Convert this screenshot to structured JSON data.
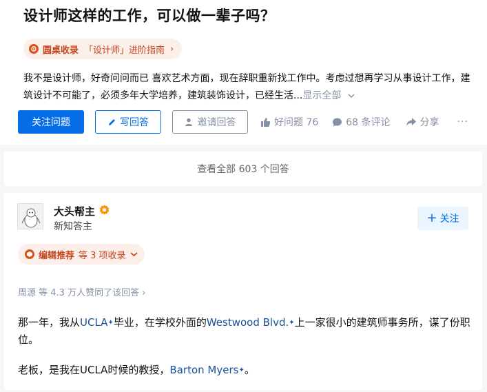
{
  "question": {
    "title": "设计师这样的工作，可以做一辈子吗？",
    "collection": {
      "name": "圆桌收录",
      "topic": "「设计师」进阶指南",
      "arrow": "›"
    },
    "description": "我不是设计师，好奇问问而已 喜欢艺术方面，现在辞职重新找工作中。考虑过想再学习从事设计工作，建筑设计不可能了，必须多年大学培养，建筑装饰设计，已经生活...",
    "show_all": "显示全部",
    "show_all_icon": "chevron-down-icon"
  },
  "actions": {
    "follow": "关注问题",
    "write": "写回答",
    "invite": "邀请回答",
    "good_question": "好问题 76",
    "comments": "68 条评论",
    "share": "分享",
    "more": "···"
  },
  "view_all": "查看全部 603 个回答",
  "answer": {
    "author": {
      "name": "大头帮主",
      "title": "新知答主"
    },
    "follow_label": "关注",
    "editor": {
      "name": "编辑推荐",
      "extra": "等 3 项收录"
    },
    "voters": "周源 等 4.3 万人赞同了该回答 ›",
    "para1": {
      "t1": "那一年，我从",
      "link1": "UCLA",
      "t2": "毕业，在学校外面的",
      "link2": "Westwood Blvd.",
      "t3": "上一家很小的建筑师事务所，谋了份职位。"
    },
    "para2": {
      "t1": "老板，是我在UCLA时候的教授，",
      "link1": "Barton Myers",
      "t2": "。"
    },
    "spark": "✦"
  },
  "colors": {
    "primary": "#056de8",
    "link": "#175199",
    "muted": "#8590a6",
    "accent_orange": "#c2461d",
    "pill_bg": "#fcefe9"
  }
}
